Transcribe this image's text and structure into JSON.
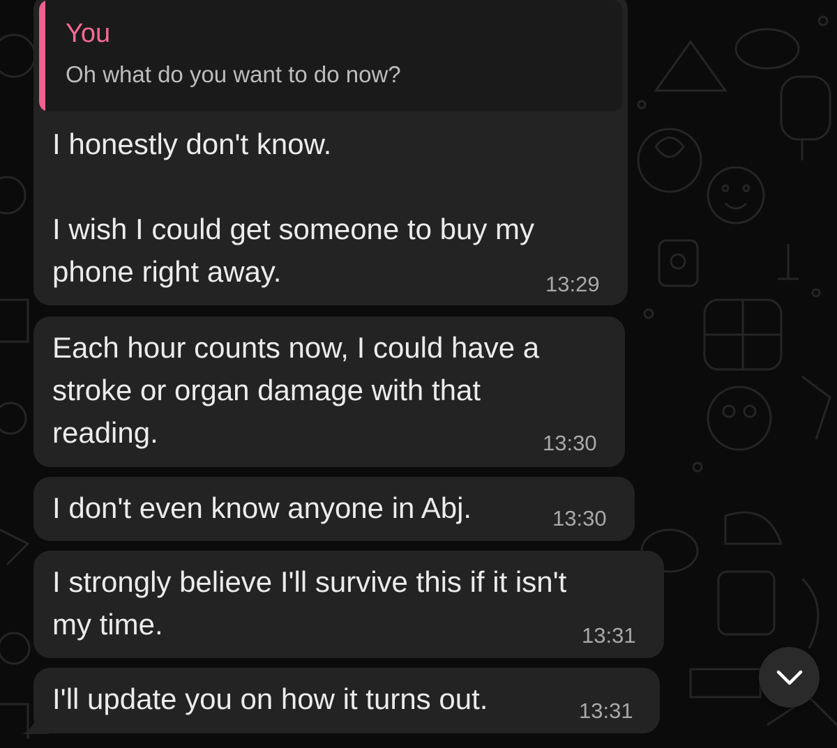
{
  "chat": {
    "messages": [
      {
        "reply": {
          "author": "You",
          "text": "Oh what do you want to do now?"
        },
        "text": "I honestly don't know.\n\nI wish I could get someone to buy my\nphone right away.",
        "time": "13:29"
      },
      {
        "text": "Each hour counts now, I could have a\nstroke or organ damage with that\nreading.",
        "time": "13:30"
      },
      {
        "text": "I don't even know anyone in Abj.",
        "time": "13:30"
      },
      {
        "text": "I strongly believe I'll survive this if it isn't\nmy time.",
        "time": "13:31"
      },
      {
        "text": "I'll update you on how it turns out.",
        "time": "13:31"
      }
    ]
  },
  "controls": {
    "scroll_down_icon": "chevron-down-icon"
  },
  "colors": {
    "bubble": "#232323",
    "quote_accent": "#f0608e",
    "background": "#0b0b0b"
  }
}
